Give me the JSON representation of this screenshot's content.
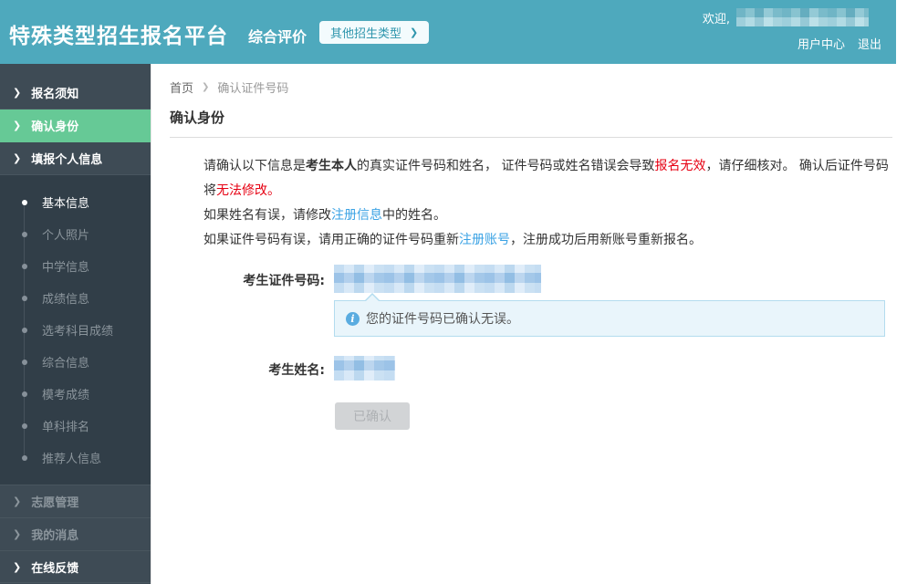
{
  "header": {
    "brand": "特殊类型招生报名平台",
    "subtitle": "综合评价",
    "other_types_label": "其他招生类型",
    "welcome_prefix": "欢迎,",
    "user_center_label": "用户中心",
    "logout_label": "退出"
  },
  "icons": {
    "chevron_right": "❯",
    "breadcrumb_separator": "❯",
    "info": "i"
  },
  "sidebar": {
    "top_items": [
      {
        "label": "报名须知"
      },
      {
        "label": "确认身份"
      },
      {
        "label": "填报个人信息"
      }
    ],
    "active_item": "确认身份",
    "sub_items": [
      {
        "label": "基本信息"
      },
      {
        "label": "个人照片"
      },
      {
        "label": "中学信息"
      },
      {
        "label": "成绩信息"
      },
      {
        "label": "选考科目成绩"
      },
      {
        "label": "综合信息"
      },
      {
        "label": "模考成绩"
      },
      {
        "label": "单科排名"
      },
      {
        "label": "推荐人信息"
      }
    ],
    "active_sub_item": "基本信息",
    "bottom_items": [
      {
        "label": "志愿管理"
      },
      {
        "label": "我的消息"
      },
      {
        "label": "在线反馈"
      }
    ]
  },
  "breadcrumb": {
    "home": "首页",
    "current": "确认证件号码"
  },
  "page": {
    "title": "确认身份"
  },
  "notice": {
    "p1_seg1": "请确认以下信息是",
    "p1_bold": "考生本人",
    "p1_seg2": "的真实证件号码和姓名， 证件号码或姓名错误会导致",
    "p1_red1": "报名无效",
    "p1_seg3": "，请仔细核对。 确认后证件号码将",
    "p1_red2": "无法修改。",
    "p2_seg1": "如果姓名有误，请修改",
    "p2_link": "注册信息",
    "p2_seg2": "中的姓名。",
    "p3_seg1": "如果证件号码有误，请用正确的证件号码重新",
    "p3_link": "注册账号",
    "p3_seg2": "，注册成功后用新账号重新报名。"
  },
  "form": {
    "id_label": "考生证件号码:",
    "id_tip": "您的证件号码已确认无误。",
    "name_label": "考生姓名:",
    "confirm_button_label": "已确认"
  },
  "colors": {
    "header_bg": "#4ea9bd",
    "sidebar_bg": "#3e4b55",
    "sidebar_sub_bg": "#313e48",
    "active_green": "#66c996",
    "link_blue": "#3aa2e4",
    "error_red": "#e60012",
    "info_box_bg": "#e9f5fb",
    "info_box_border": "#b3dcef"
  }
}
